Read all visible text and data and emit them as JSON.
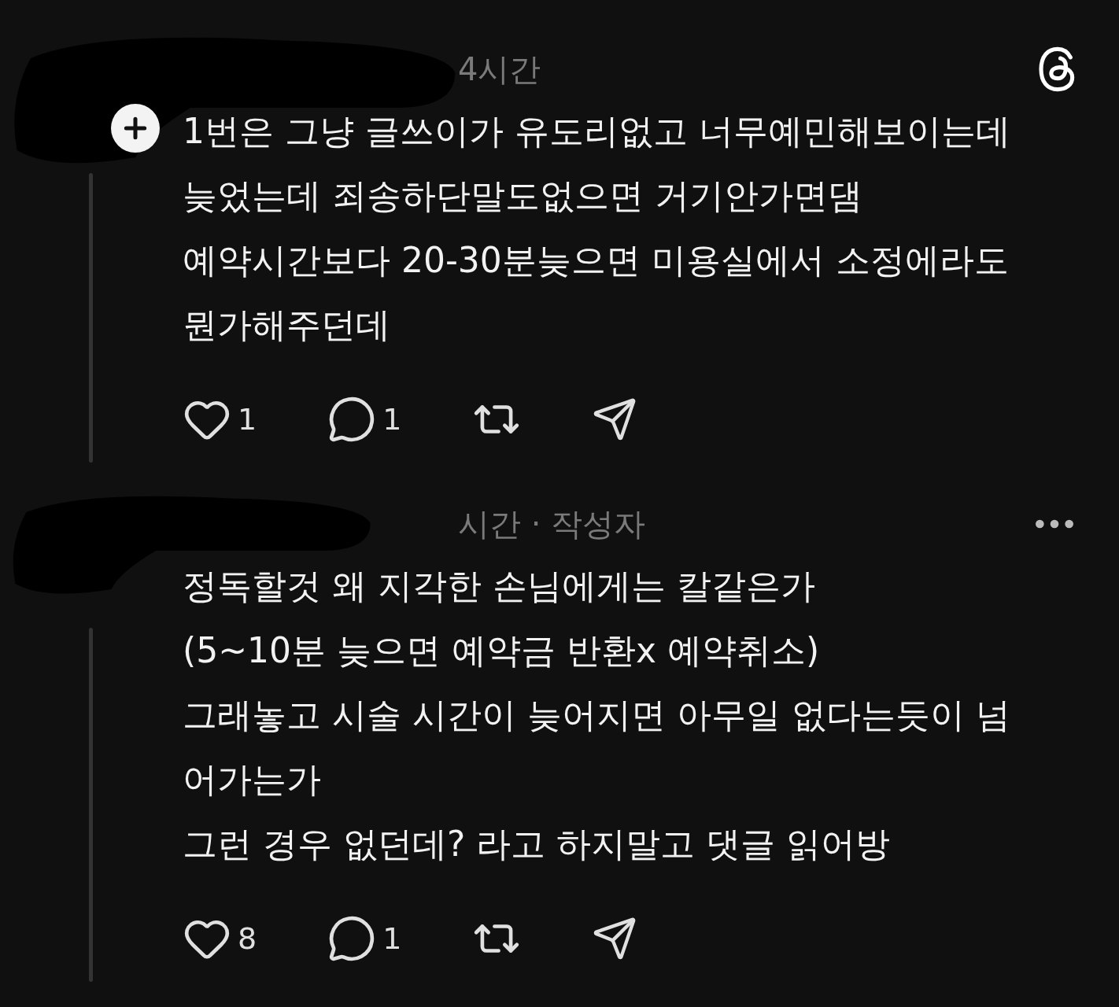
{
  "posts": [
    {
      "meta": "4시간",
      "follow_badge": true,
      "corner_icon": {
        "kind": "logo"
      },
      "lines": [
        "1번은 그냥 글쓰이가 유도리없고 너무예민해보이는데",
        "늦었는데 죄송하단말도없으면 거기안가면댐",
        "예약시간보다 20-30분늦으면 미용실에서 소정에라도",
        "뭔가해주던데"
      ],
      "likes": "1",
      "replies": "1"
    },
    {
      "meta": "시간 · 작성자",
      "follow_badge": false,
      "corner_icon": {
        "kind": "more"
      },
      "lines": [
        "정독할것 왜 지각한 손님에게는 칼같은가",
        "(5~10분 늦으면 예약금 반환x 예약취소)",
        "그래놓고 시술 시간이 늦어지면 아무일 없다는듯이 넘",
        "어가는가",
        "그런 경우 없던데? 라고 하지말고 댓글 읽어방"
      ],
      "likes": "8",
      "replies": "1"
    }
  ]
}
